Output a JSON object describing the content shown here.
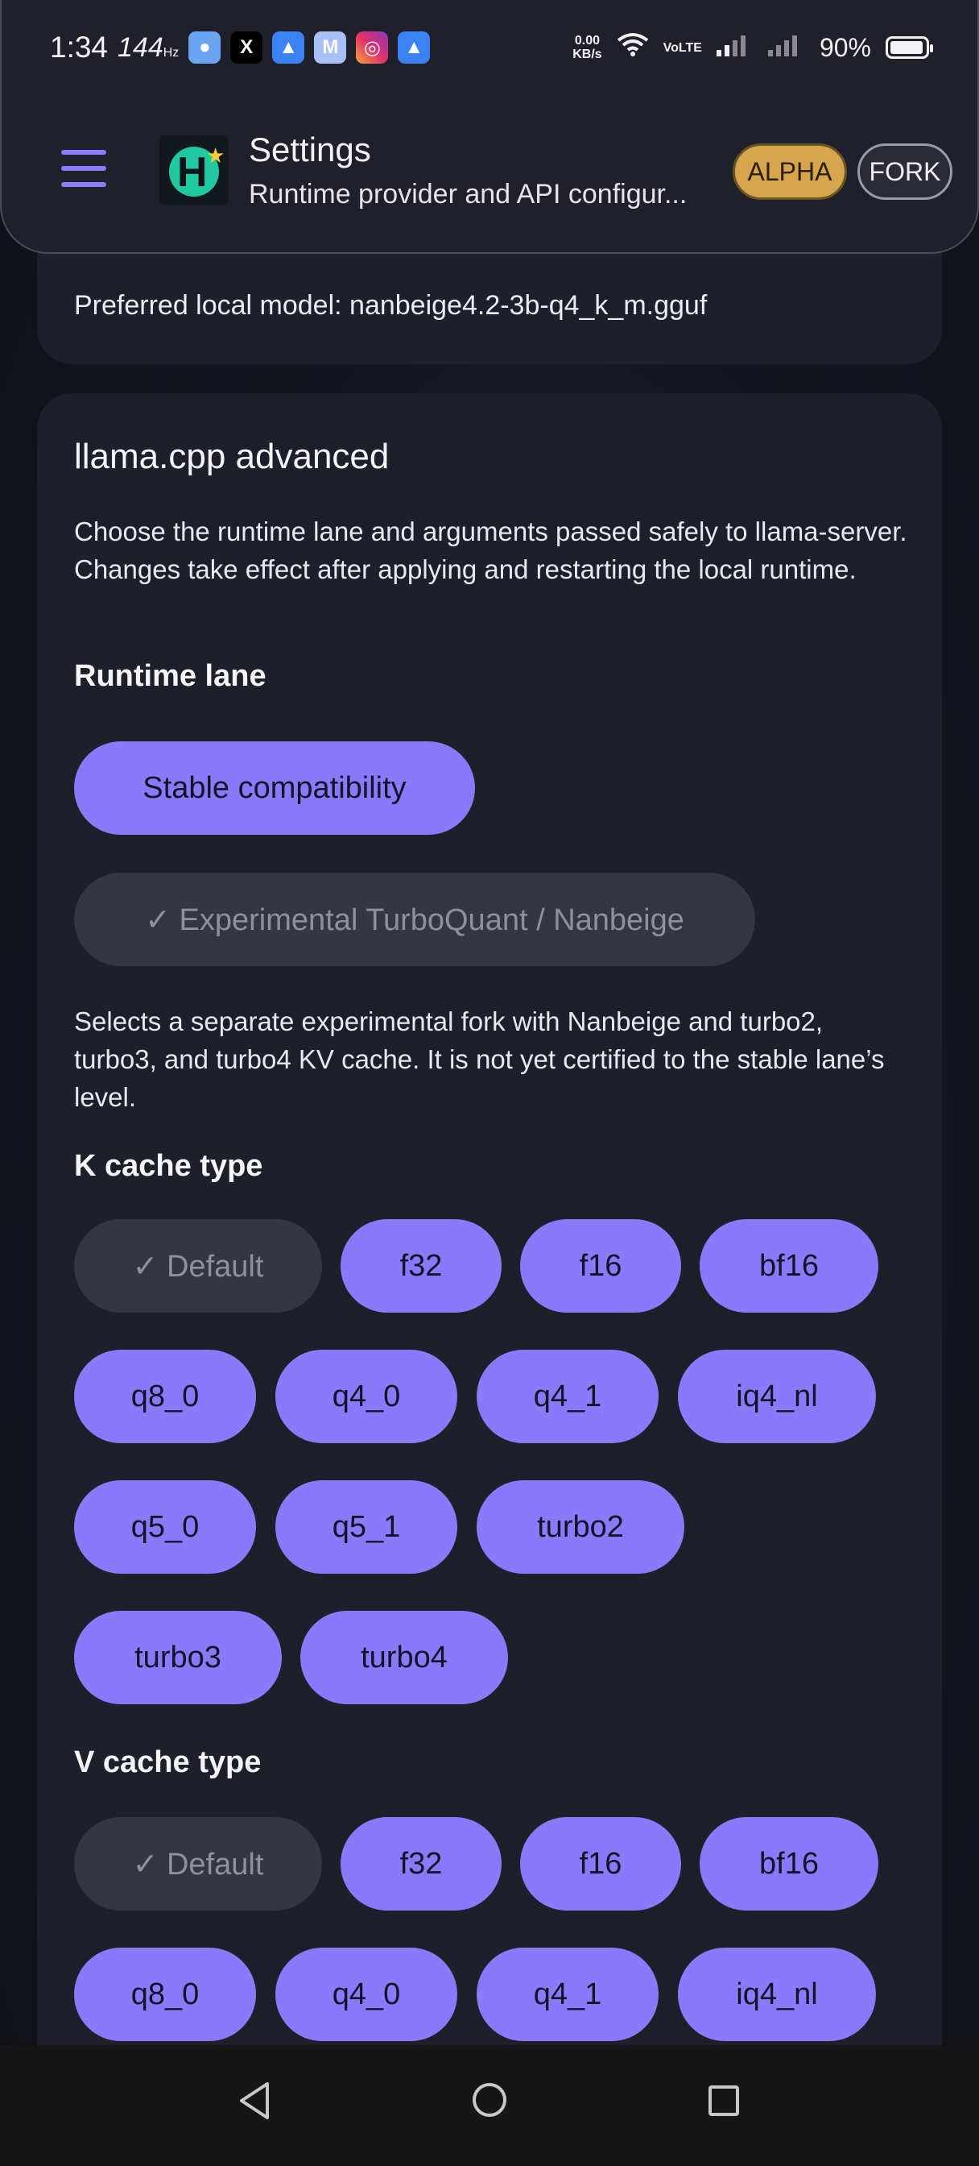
{
  "status_bar": {
    "time": "1:34",
    "refresh_rate": "144",
    "refresh_unit": "Hz",
    "net_speed": "0.00",
    "net_unit": "KB/s",
    "volte": "VoLTE",
    "battery": "90%"
  },
  "header": {
    "title": "Settings",
    "subtitle": "Runtime provider and API configur...",
    "badges": [
      "ALPHA",
      "FORK"
    ],
    "colors": {
      "accent": "#8a7af9",
      "alpha_badge": "#d7a54c"
    }
  },
  "prev_card": {
    "preferred_model": "Preferred local model: nanbeige4.2-3b-q4_k_m.gguf"
  },
  "llama": {
    "title": "llama.cpp advanced",
    "description": "Choose the runtime lane and arguments passed safely to llama-server. Changes take effect after applying and restarting the local runtime.",
    "runtime_lane_label": "Runtime lane",
    "lanes": [
      {
        "label": "Stable compatibility",
        "selected": false
      },
      {
        "label": "✓ Experimental TurboQuant / Nanbeige",
        "selected": true
      }
    ],
    "lane_note": "Selects a separate experimental fork with Nanbeige and turbo2, turbo3, and turbo4 KV cache. It is not yet certified to the stable lane’s level.",
    "k_cache_label": "K cache type",
    "k_cache_options": [
      "✓ Default",
      "f32",
      "f16",
      "bf16",
      "q8_0",
      "q4_0",
      "q4_1",
      "iq4_nl",
      "q5_0",
      "q5_1",
      "turbo2",
      "turbo3",
      "turbo4"
    ],
    "v_cache_label": "V cache type",
    "v_cache_options": [
      "✓ Default",
      "f32",
      "f16",
      "bf16",
      "q8_0",
      "q4_0",
      "q4_1",
      "iq4_nl"
    ]
  }
}
